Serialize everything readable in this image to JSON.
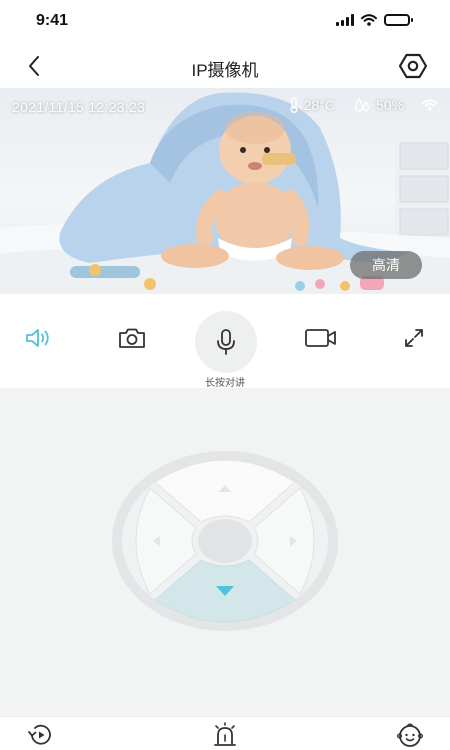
{
  "status_bar": {
    "time": "9:41"
  },
  "header": {
    "title": "IP摄像机"
  },
  "video": {
    "timestamp": "2021/11/15 12:23:23",
    "temperature": "28°C",
    "humidity": "50%",
    "quality_label": "高清"
  },
  "controls": {
    "items": [
      {
        "name": "speaker",
        "icon": "speaker-icon",
        "active": true
      },
      {
        "name": "snapshot",
        "icon": "camera-icon"
      },
      {
        "name": "talk",
        "icon": "microphone-icon"
      },
      {
        "name": "record",
        "icon": "video-record-icon"
      },
      {
        "name": "fullscreen",
        "icon": "fullscreen-icon"
      }
    ],
    "talk_label": "长按对讲"
  },
  "ptz": {
    "pressed_direction": "down"
  },
  "tab_bar": {
    "items": [
      {
        "name": "playback",
        "icon": "playback-icon"
      },
      {
        "name": "alarm",
        "icon": "alarm-icon"
      },
      {
        "name": "baby",
        "icon": "baby-face-icon"
      }
    ]
  },
  "colors": {
    "accent": "#4fc3d8",
    "pressed": "#d3e6ea"
  }
}
